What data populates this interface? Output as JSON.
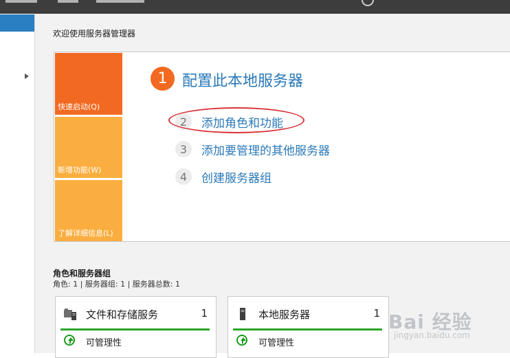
{
  "colors": {
    "accent_blue": "#2b79b8",
    "tile_orange": "#f26a21",
    "tile_amber": "#fbae40",
    "status_green": "#2aa52a",
    "annotation_red": "#d9343a"
  },
  "welcome": {
    "title": "欢迎使用服务器管理器",
    "tiles": [
      {
        "label": "快速启动(Q)"
      },
      {
        "label": "新增功能(W)"
      },
      {
        "label": "了解详细信息(L)"
      }
    ],
    "steps": [
      {
        "number": "1",
        "label": "配置此本地服务器"
      },
      {
        "number": "2",
        "label": "添加角色和功能"
      },
      {
        "number": "3",
        "label": "添加要管理的其他服务器"
      },
      {
        "number": "4",
        "label": "创建服务器组"
      }
    ]
  },
  "roles": {
    "title": "角色和服务器组",
    "summary": "角色: 1 | 服务器组: 1 | 服务器总数: 1",
    "cards": [
      {
        "icon": "folder-server-icon",
        "title": "文件和存储服务",
        "count": "1",
        "status": "可管理性",
        "status_icon": "arrow-up-icon"
      },
      {
        "icon": "server-icon",
        "title": "本地服务器",
        "count": "1",
        "status": "可管理性",
        "status_icon": "arrow-up-icon"
      }
    ]
  },
  "watermark": {
    "main": "Bai 经验",
    "sub": "jingyan.baidu.com"
  }
}
